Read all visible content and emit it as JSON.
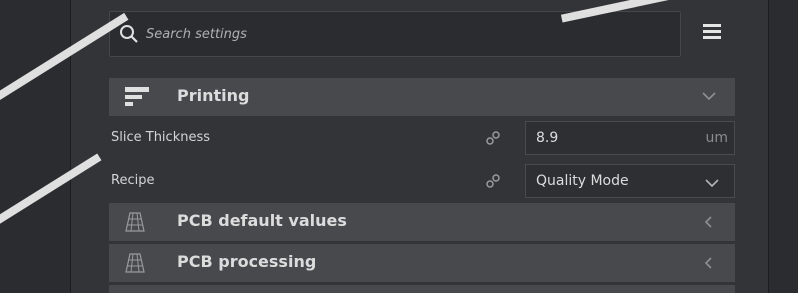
{
  "search": {
    "placeholder": "Search settings"
  },
  "sections": [
    {
      "label": "Printing",
      "icon": "printer-icon",
      "state": "expanded"
    },
    {
      "label": "PCB default values",
      "icon": "pcb-layers-icon",
      "state": "collapsed"
    },
    {
      "label": "PCB processing",
      "icon": "pcb-layers-icon",
      "state": "collapsed"
    }
  ],
  "settings": [
    {
      "label": "Slice Thickness",
      "value": "8.9",
      "unit": "um"
    },
    {
      "label": "Recipe",
      "value": "Quality Mode"
    }
  ],
  "colors": {
    "panel": "#333438",
    "category": "#48494d",
    "text": "#dcdcdc",
    "field": "#2e2f33"
  }
}
